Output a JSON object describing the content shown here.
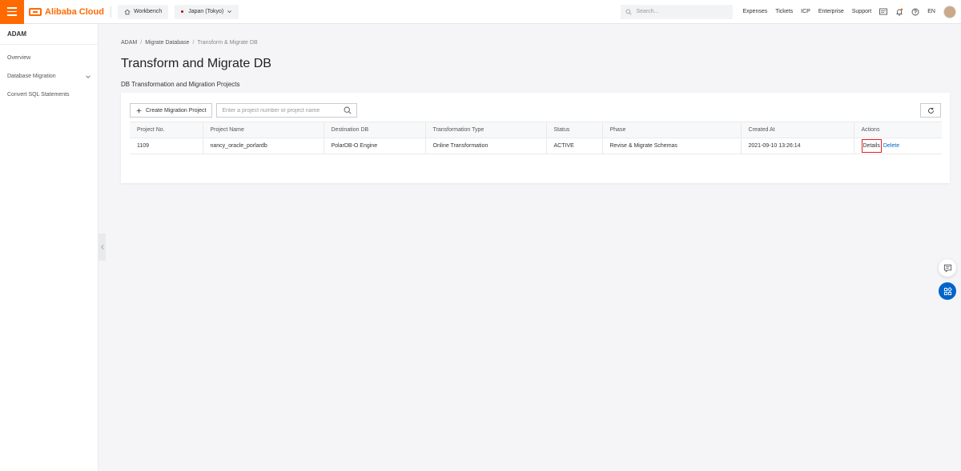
{
  "topbar": {
    "brand": "Alibaba Cloud",
    "workbench": "Workbench",
    "region": "Japan (Tokyo)",
    "search_placeholder": "Search...",
    "nav": [
      "Expenses",
      "Tickets",
      "ICP",
      "Enterprise",
      "Support"
    ],
    "language": "EN"
  },
  "sidebar": {
    "title": "ADAM",
    "items": [
      {
        "label": "Overview"
      },
      {
        "label": "Database Migration"
      },
      {
        "label": "Convert SQL Statements"
      }
    ]
  },
  "breadcrumb": [
    "ADAM",
    "Migrate Database",
    "Transform & Migrate DB"
  ],
  "page": {
    "title": "Transform and Migrate DB",
    "subtitle": "DB Transformation and Migration Projects"
  },
  "toolbar": {
    "create_label": "Create Migration Project",
    "search_placeholder": "Enter a project number or project name"
  },
  "table": {
    "headers": [
      "Project No.",
      "Project Name",
      "Destination DB",
      "Transformation Type",
      "Status",
      "Phase",
      "Created At",
      "Actions"
    ],
    "rows": [
      {
        "project_no": "1109",
        "project_name": "nancy_oracle_porlardb",
        "destination_db": "PolarDB-O Engine",
        "transformation_type": "Online Transformation",
        "status": "ACTIVE",
        "phase": "Revise & Migrate Schemas",
        "created_at": "2021-09-10 13:26:14",
        "actions": [
          "Details",
          "Delete"
        ]
      }
    ]
  },
  "colors": {
    "brand": "#ff6a00",
    "link": "#0064c8",
    "status_active": "#1e8e3e",
    "highlight": "#e02020"
  }
}
